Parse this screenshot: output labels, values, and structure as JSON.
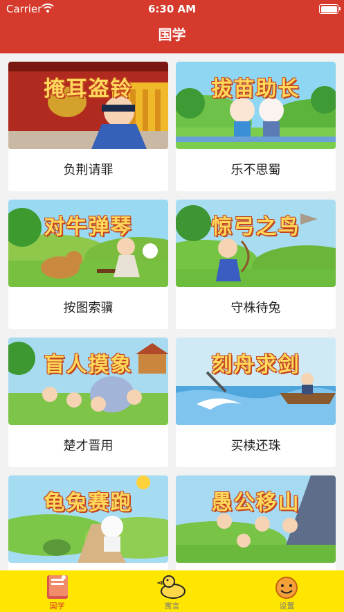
{
  "status_bar": {
    "carrier": "Carrier",
    "time": "6:30 AM"
  },
  "nav": {
    "title": "国学"
  },
  "cards": [
    {
      "image_title": "掩耳盗铃",
      "label": "负荆请罪"
    },
    {
      "image_title": "拔苗助长",
      "label": "乐不思蜀"
    },
    {
      "image_title": "对牛弹琴",
      "label": "按图索骥"
    },
    {
      "image_title": "惊弓之鸟",
      "label": "守株待兔"
    },
    {
      "image_title": "盲人摸象",
      "label": "楚才晋用"
    },
    {
      "image_title": "刻舟求剑",
      "label": "买椟还珠"
    },
    {
      "image_title": "龟兔赛跑",
      "label": ""
    },
    {
      "image_title": "愚公移山",
      "label": ""
    }
  ],
  "tabs": [
    {
      "label": "国学",
      "icon": "book-icon",
      "active": true
    },
    {
      "label": "寓言",
      "icon": "duck-icon",
      "active": false
    },
    {
      "label": "设置",
      "icon": "face-icon",
      "active": false
    }
  ],
  "colors": {
    "brand_red": "#d53a2c",
    "tabbar_yellow": "#ffe600",
    "card_bg": "#ffffff",
    "page_bg": "#f2f2f2"
  }
}
